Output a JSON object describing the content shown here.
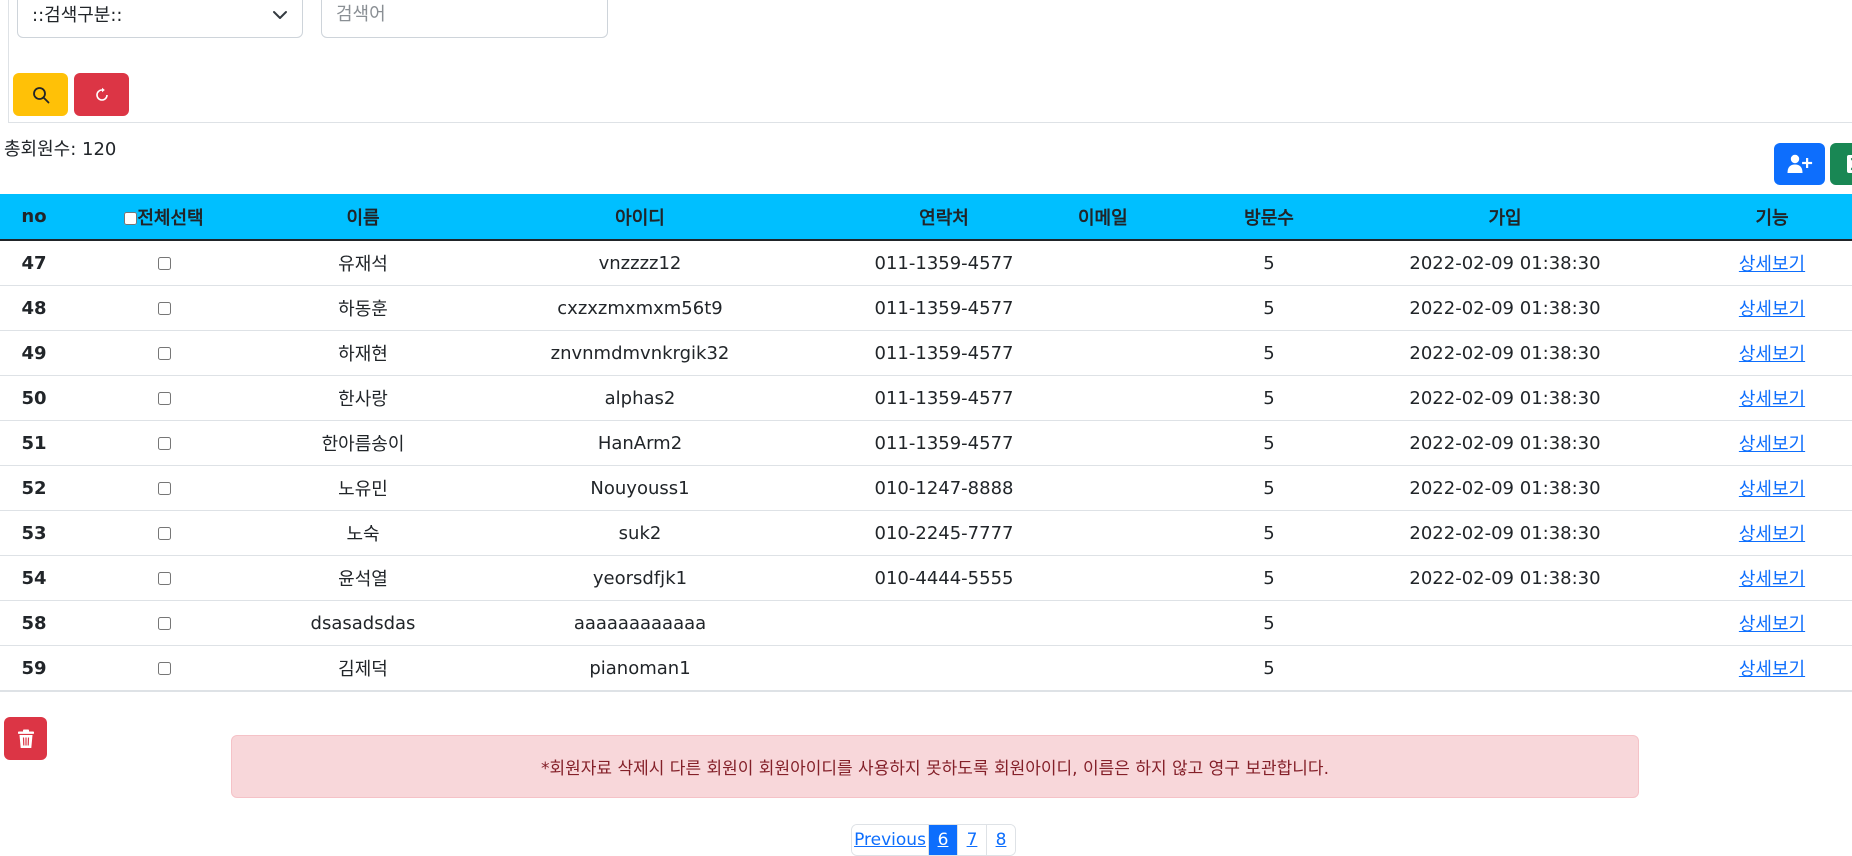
{
  "search": {
    "select_value": "::검색구분::",
    "keyword_placeholder": "검색어"
  },
  "summary": {
    "total_label": "총회원수: 120"
  },
  "table": {
    "headers": [
      "no",
      "전체선택",
      "이름",
      "아이디",
      "연락처",
      "이메일",
      "방문수",
      "가입",
      "기능"
    ],
    "rows": [
      {
        "no": "47",
        "name": "유재석",
        "id": "vnzzzz12",
        "phone": "011-1359-4577",
        "email": "",
        "visits": "5",
        "joined": "2022-02-09 01:38:30",
        "action": "상세보기"
      },
      {
        "no": "48",
        "name": "하동훈",
        "id": "cxzxzmxmxm56t9",
        "phone": "011-1359-4577",
        "email": "",
        "visits": "5",
        "joined": "2022-02-09 01:38:30",
        "action": "상세보기"
      },
      {
        "no": "49",
        "name": "하재현",
        "id": "znvnmdmvnkrgik32",
        "phone": "011-1359-4577",
        "email": "",
        "visits": "5",
        "joined": "2022-02-09 01:38:30",
        "action": "상세보기"
      },
      {
        "no": "50",
        "name": "한사랑",
        "id": "alphas2",
        "phone": "011-1359-4577",
        "email": "",
        "visits": "5",
        "joined": "2022-02-09 01:38:30",
        "action": "상세보기"
      },
      {
        "no": "51",
        "name": "한아름송이",
        "id": "HanArm2",
        "phone": "011-1359-4577",
        "email": "",
        "visits": "5",
        "joined": "2022-02-09 01:38:30",
        "action": "상세보기"
      },
      {
        "no": "52",
        "name": "노유민",
        "id": "Nouyouss1",
        "phone": "010-1247-8888",
        "email": "",
        "visits": "5",
        "joined": "2022-02-09 01:38:30",
        "action": "상세보기"
      },
      {
        "no": "53",
        "name": "노숙",
        "id": "suk2",
        "phone": "010-2245-7777",
        "email": "",
        "visits": "5",
        "joined": "2022-02-09 01:38:30",
        "action": "상세보기"
      },
      {
        "no": "54",
        "name": "윤석열",
        "id": "yeorsdfjk1",
        "phone": "010-4444-5555",
        "email": "",
        "visits": "5",
        "joined": "2022-02-09 01:38:30",
        "action": "상세보기"
      },
      {
        "no": "58",
        "name": "dsasadsdas",
        "id": "aaaaaaaaaaaa",
        "phone": "",
        "email": "",
        "visits": "5",
        "joined": "",
        "action": "상세보기"
      },
      {
        "no": "59",
        "name": "김제덕",
        "id": "pianoman1",
        "phone": "",
        "email": "",
        "visits": "5",
        "joined": "",
        "action": "상세보기"
      }
    ]
  },
  "notice": {
    "text": "*회원자료 삭제시 다른 회원이 회원아이디를 사용하지 못하도록 회원아이디, 이름은 하지 않고 영구 보관합니다."
  },
  "pagination": {
    "previous_label": "Previous",
    "pages": [
      "6",
      "7",
      "8"
    ],
    "active_page": "6"
  },
  "colors": {
    "header_bg": "#00bfff",
    "search_button": "#ffc107",
    "reset_button": "#dc3545",
    "add_button": "#0d6efd",
    "excel_button": "#198754",
    "delete_button": "#dc3545",
    "alert_bg": "#f8d7da",
    "link": "#0d6efd"
  },
  "icons": {
    "search": "search-icon",
    "reset": "refresh-icon",
    "add_user": "user-plus-icon",
    "excel": "excel-icon",
    "delete": "trash-icon",
    "select": "chevron-down-icon"
  }
}
